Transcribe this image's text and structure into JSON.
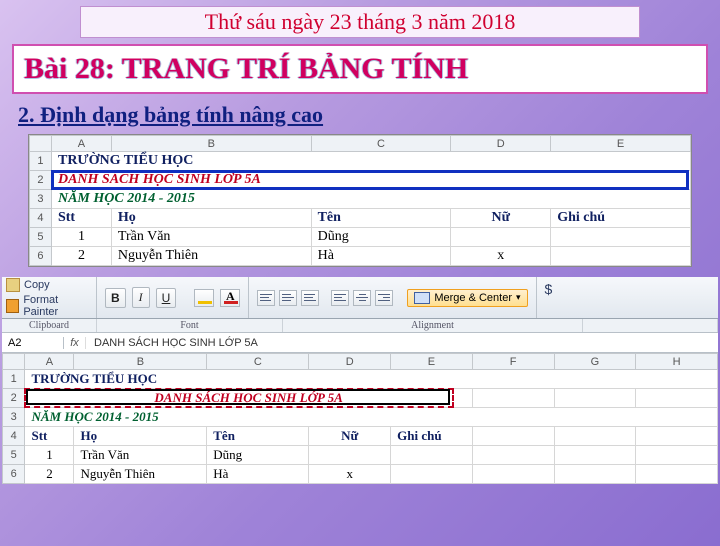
{
  "date": "Thứ sáu ngày 23 tháng 3 năm 2018",
  "title": "Bài 28: TRANG TRÍ BẢNG TÍNH",
  "subtitle": "2. Định dạng bảng tính nâng cao",
  "sheet1": {
    "cols": [
      "",
      "A",
      "B",
      "C",
      "D",
      "E"
    ],
    "rows": [
      {
        "n": "1",
        "a": "TRƯỜNG TIỂU HỌC",
        "cls": "s1-title1"
      },
      {
        "n": "2",
        "a": "DANH SÁCH HỌC SINH LỚP 5A",
        "cls": "s1-title2"
      },
      {
        "n": "3",
        "a": "NĂM HỌC 2014 - 2015",
        "cls": "s1-title3"
      },
      {
        "n": "4",
        "cells": [
          "Stt",
          "Họ",
          "Tên",
          "Nữ",
          "Ghi chú"
        ],
        "cls": "s1-hdr"
      },
      {
        "n": "5",
        "cells": [
          "1",
          "Trần Văn",
          "Dũng",
          "",
          ""
        ]
      },
      {
        "n": "6",
        "cells": [
          "2",
          "Nguyễn Thiên",
          "Hà",
          "x",
          ""
        ]
      }
    ]
  },
  "ribbon": {
    "copy": "Copy",
    "painter": "Format Painter",
    "bold": "B",
    "italic": "I",
    "underline": "U",
    "merge": "Merge & Center",
    "dollar": "$",
    "groups": {
      "clipboard": "Clipboard",
      "font": "Font",
      "alignment": "Alignment"
    }
  },
  "formula": {
    "name": "A2",
    "fx": "fx",
    "value": "DANH SÁCH HỌC SINH LỚP 5A"
  },
  "sheet2": {
    "cols": [
      "",
      "A",
      "B",
      "C",
      "D",
      "E",
      "F",
      "G",
      "H"
    ],
    "rows": [
      {
        "n": "1",
        "a": "TRƯỜNG TIỂU HỌC",
        "cls": "s2-title1"
      },
      {
        "n": "2",
        "a": "DANH SÁCH HỌC SINH LỚP 5A",
        "cls": "s2-sel"
      },
      {
        "n": "3",
        "a": "NĂM HỌC 2014 - 2015",
        "cls": "s2-title3"
      },
      {
        "n": "4",
        "cells": [
          "Stt",
          "Họ",
          "Tên",
          "Nữ",
          "Ghi chú",
          "",
          "",
          ""
        ],
        "cls": "s2-hdr"
      },
      {
        "n": "5",
        "cells": [
          "1",
          "Trần Văn",
          "Dũng",
          "",
          "",
          "",
          "",
          ""
        ]
      },
      {
        "n": "6",
        "cells": [
          "2",
          "Nguyễn Thiên",
          "Hà",
          "x",
          "",
          "",
          "",
          ""
        ]
      }
    ]
  }
}
